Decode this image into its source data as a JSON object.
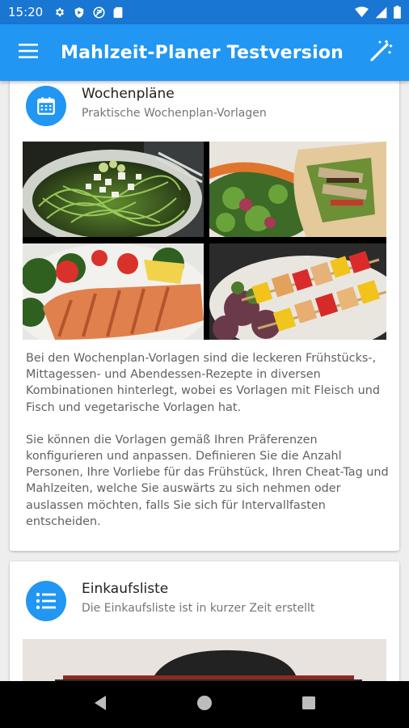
{
  "status_bar": {
    "time": "15:20",
    "left_icons": [
      "gear-icon",
      "shield-icon",
      "vpn-icon",
      "sd-card-icon"
    ],
    "right_icons": [
      "wifi-icon",
      "signal-icon",
      "battery-icon"
    ]
  },
  "app_bar": {
    "title": "Mahlzeit-Planer Testversion",
    "menu_icon": "hamburger-menu-icon",
    "action_icon": "magic-wand-icon"
  },
  "cards": [
    {
      "icon": "calendar-icon",
      "title": "Wochenpläne",
      "subtitle": "Praktische Wochenplan-Vorlagen",
      "images": [
        "zucchini-noodle-salad",
        "veggie-wrap-with-salad",
        "salmon-fillet-with-tomato-salad",
        "vegetable-chicken-skewers"
      ],
      "paragraphs": [
        "Bei den Wochenplan-Vorlagen sind die leckeren Frühstücks-, Mittagessen- und Abendessen-Rezepte in diversen Kombinationen hinterlegt, wobei es Vorlagen mit Fleisch und Fisch und vegetarische Vorlagen hat.",
        "Sie können die Vorlagen gemäß Ihren Präferenzen konfigurieren und anpassen. Definieren Sie die Anzahl Personen, Ihre Vorliebe für das Frühstück, Ihren Cheat-Tag und Mahlzeiten, welche Sie auswärts zu sich nehmen oder auslassen möchten, falls Sie sich für Intervallfasten entscheiden."
      ]
    },
    {
      "icon": "list-icon",
      "title": "Einkaufsliste",
      "subtitle": "Die Einkaufsliste ist in kurzer Zeit erstellt",
      "images": [
        "shopping-basket-photo"
      ]
    }
  ],
  "nav_bar": {
    "buttons": [
      "back-icon",
      "home-icon",
      "recents-icon"
    ]
  },
  "colors": {
    "status_bar": "#1976d2",
    "app_bar": "#2196f3",
    "icon_circle": "#2196f3",
    "background": "#eeeeee"
  }
}
